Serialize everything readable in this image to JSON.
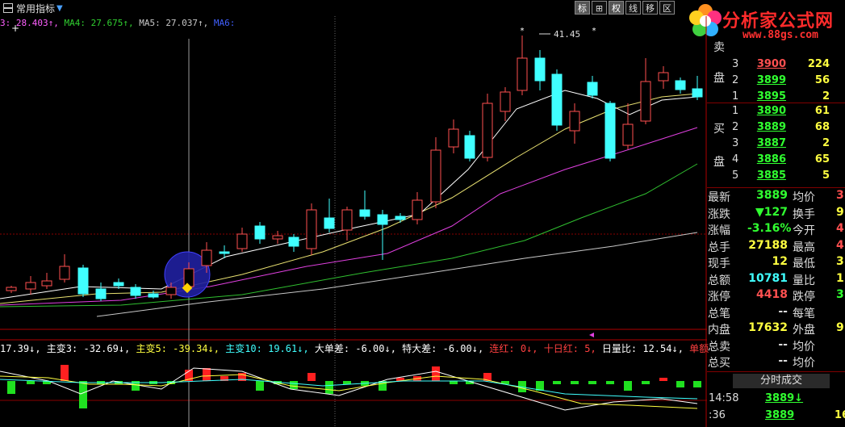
{
  "toolbar": {
    "indicator_select": "常用指标",
    "tools": [
      {
        "label": "标",
        "active": true
      },
      {
        "label": "⊞",
        "active": false
      },
      {
        "label": "权",
        "active": true
      },
      {
        "label": "线",
        "active": false
      },
      {
        "label": "移",
        "active": false
      },
      {
        "label": "区",
        "active": false
      }
    ]
  },
  "logo": {
    "cn": "分析家公式网",
    "url": "www.88gs.com"
  },
  "ma_row": [
    {
      "text": "3: 28.403↑,",
      "color": "#ff60ff"
    },
    {
      "text": " MA4: 27.675↑,",
      "color": "#30d030"
    },
    {
      "text": " MA5: 27.037↑,",
      "color": "#c8c8c8"
    },
    {
      "text": " MA6:",
      "color": "#4060ff"
    }
  ],
  "chart": {
    "high_label": "41.45",
    "colors": {
      "up": "#ff5050",
      "down": "#40ffff",
      "ma1": "#ffffff",
      "ma2": "#e8e070",
      "ma3": "#e040e0",
      "ma4": "#30c030",
      "ma5": "#c8c8c8"
    }
  },
  "indicator_row": [
    {
      "text": "17.39↓,",
      "color": "#ffffff"
    },
    {
      "text": " 主变3: -32.69↓,",
      "color": "#ffffff"
    },
    {
      "text": " 主变5: -39.34↓,",
      "color": "#ffff40"
    },
    {
      "text": " 主变10: 19.61↓,",
      "color": "#40ffff"
    },
    {
      "text": " 大单差: -6.00↓,",
      "color": "#ffffff"
    },
    {
      "text": " 特大差: -6.00↓,",
      "color": "#ffffff"
    },
    {
      "text": " 连红: 0↓,",
      "color": "#ff4040"
    },
    {
      "text": " 十日红: 5,",
      "color": "#ff4040"
    },
    {
      "text": " 日量比: 12.54↓,",
      "color": "#ffffff"
    },
    {
      "text": " 单额",
      "color": "#ff4040"
    }
  ],
  "order_book": {
    "sell_label_top": "卖",
    "sell_label": "盘",
    "buy_label_top": "买",
    "buy_label": "盘",
    "sell": [
      {
        "level": "3",
        "price": "3900",
        "volume": "224",
        "color": "#ff5050"
      },
      {
        "level": "2",
        "price": "3899",
        "volume": "56",
        "color": "#30ff30"
      },
      {
        "level": "1",
        "price": "3895",
        "volume": "2",
        "color": "#30ff30"
      }
    ],
    "buy": [
      {
        "level": "1",
        "price": "3890",
        "volume": "61",
        "color": "#30ff30"
      },
      {
        "level": "2",
        "price": "3889",
        "volume": "68",
        "color": "#30ff30"
      },
      {
        "level": "3",
        "price": "3887",
        "volume": "2",
        "color": "#30ff30"
      },
      {
        "level": "4",
        "price": "3886",
        "volume": "65",
        "color": "#30ff30"
      },
      {
        "level": "5",
        "price": "3885",
        "volume": "5",
        "color": "#30ff30"
      }
    ]
  },
  "quotes": [
    {
      "l1": "最新",
      "v1": "3889",
      "c1": "#30ff30",
      "l2": "均价",
      "v2": "3",
      "c2": "#ff5050"
    },
    {
      "l1": "涨跌",
      "v1": "▼127",
      "c1": "#30ff30",
      "l2": "换手",
      "v2": "9",
      "c2": "#ffff40"
    },
    {
      "l1": "涨幅",
      "v1": "-3.16%",
      "c1": "#30ff30",
      "l2": "今开",
      "v2": "4",
      "c2": "#ff5050"
    },
    {
      "l1": "总手",
      "v1": "27188",
      "c1": "#ffff40",
      "l2": "最高",
      "v2": "4",
      "c2": "#ff5050"
    },
    {
      "l1": "现手",
      "v1": "12",
      "c1": "#ffff40",
      "l2": "最低",
      "v2": "3",
      "c2": "#ffff40"
    },
    {
      "l1": "总额",
      "v1": "10781",
      "c1": "#40ffff",
      "l2": "量比",
      "v2": "1",
      "c2": "#ffff40"
    },
    {
      "l1": "涨停",
      "v1": "4418",
      "c1": "#ff5050",
      "l2": "跌停",
      "v2": "3",
      "c2": "#30ff30"
    },
    {
      "l1": "总笔",
      "v1": "--",
      "c1": "#ddd",
      "l2": "每笔",
      "v2": "",
      "c2": "#ddd"
    },
    {
      "l1": "内盘",
      "v1": "17632",
      "c1": "#ffff40",
      "l2": "外盘",
      "v2": "9",
      "c2": "#ffff40"
    },
    {
      "l1": "总卖",
      "v1": "--",
      "c1": "#ddd",
      "l2": "均价",
      "v2": "",
      "c2": "#ddd"
    },
    {
      "l1": "总买",
      "v1": "--",
      "c1": "#ddd",
      "l2": "均价",
      "v2": "",
      "c2": "#ddd"
    }
  ],
  "trades_tab": "分时成交",
  "trades": [
    {
      "time": "14:58",
      "price": "3889",
      "arrow": "↓",
      "vol": "",
      "vcolor": "#ffff40"
    },
    {
      "time": ":36",
      "price": "3889",
      "arrow": "",
      "vol": "16",
      "vcolor": "#ffff40"
    }
  ]
}
